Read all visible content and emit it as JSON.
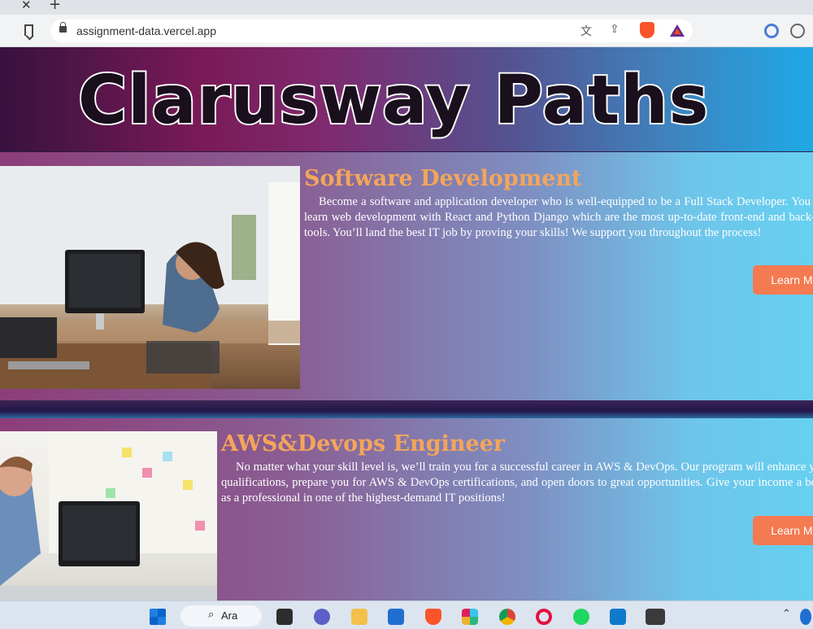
{
  "browser": {
    "url": "assignment-data.vercel.app",
    "tab_close_glyph": "✕",
    "new_tab_glyph": "+"
  },
  "hero": {
    "title": "Clarusway Paths"
  },
  "cards": [
    {
      "title": "Software Development",
      "text": "Become a software and application developer who is well-equipped to be a Full Stack Developer. You will learn web development with React and Python Django which are the most up-to-date front-end and back-end tools. You’ll land the best IT job by proving your skills! We support you throughout the process!",
      "button": "Learn More"
    },
    {
      "title": "AWS&Devops Engineer",
      "text": "No matter what your skill level is, we’ll train you for a successful career in AWS & DevOps. Our program will enhance your qualifications, prepare you for AWS & DevOps certifications, and open doors to great opportunities. Give your income a boost as a professional in one of the highest-demand IT positions!",
      "button": "Learn More"
    }
  ],
  "taskbar": {
    "search_label": "Ara",
    "tray_chevron": "⌃"
  },
  "colors": {
    "accent_title": "#f3a55a",
    "button": "#f47a52"
  }
}
